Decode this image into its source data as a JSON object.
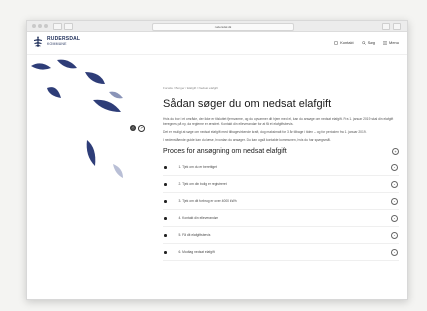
{
  "browser": {
    "address": "rudersdal.dk"
  },
  "header": {
    "logo_name": "RUDERSDAL",
    "logo_sub": "KOMMUNE",
    "nav": [
      {
        "label": "Kontakt",
        "icon": "phone-icon"
      },
      {
        "label": "Søg",
        "icon": "search-icon"
      },
      {
        "label": "Menu",
        "icon": "menu-icon"
      }
    ]
  },
  "breadcrumb": "Forside / Borger / Elafgift / Nedsat elafgift",
  "title": "Sådan søger du om nedsat elafgift",
  "paragraphs": [
    "Hvis du bor i et område, der ikke er tilsluttet fjernvarme, og du opvarmer dit hjem med el, kan du ansøge om nedsat elafgift. Fra 1. januar 2019 skal din elafgift beregnes på ny, da reglerne er ændret. Kontakt din elleverandør for at få et elafgiftsbevis.",
    "Det er muligt at søge om nedsat elafgift med tilbagevirkende kraft, dog maksimalt for 3 år tilbage i tiden – og for perioden fra 1. januar 2019.",
    "I nedenstående guide kan du læse, hvordan du ansøger. Du kan også kontakte kommunen, hvis du har spørgsmål."
  ],
  "section": {
    "title": "Proces for ansøgning om nedsat elafgift",
    "steps": [
      "1. Tjek om du er berettiget",
      "2. Tjek om din bolig er registreret",
      "3. Tjek om dit forbrug er over 4000 kWh",
      "4. Kontakt din elleverandør",
      "5. Få dit elafgiftsbevis",
      "6. Modtag nedsat elafgift"
    ]
  },
  "colors": {
    "brand_navy": "#1f2f5a",
    "leaf_blue": "#2e3d78"
  }
}
